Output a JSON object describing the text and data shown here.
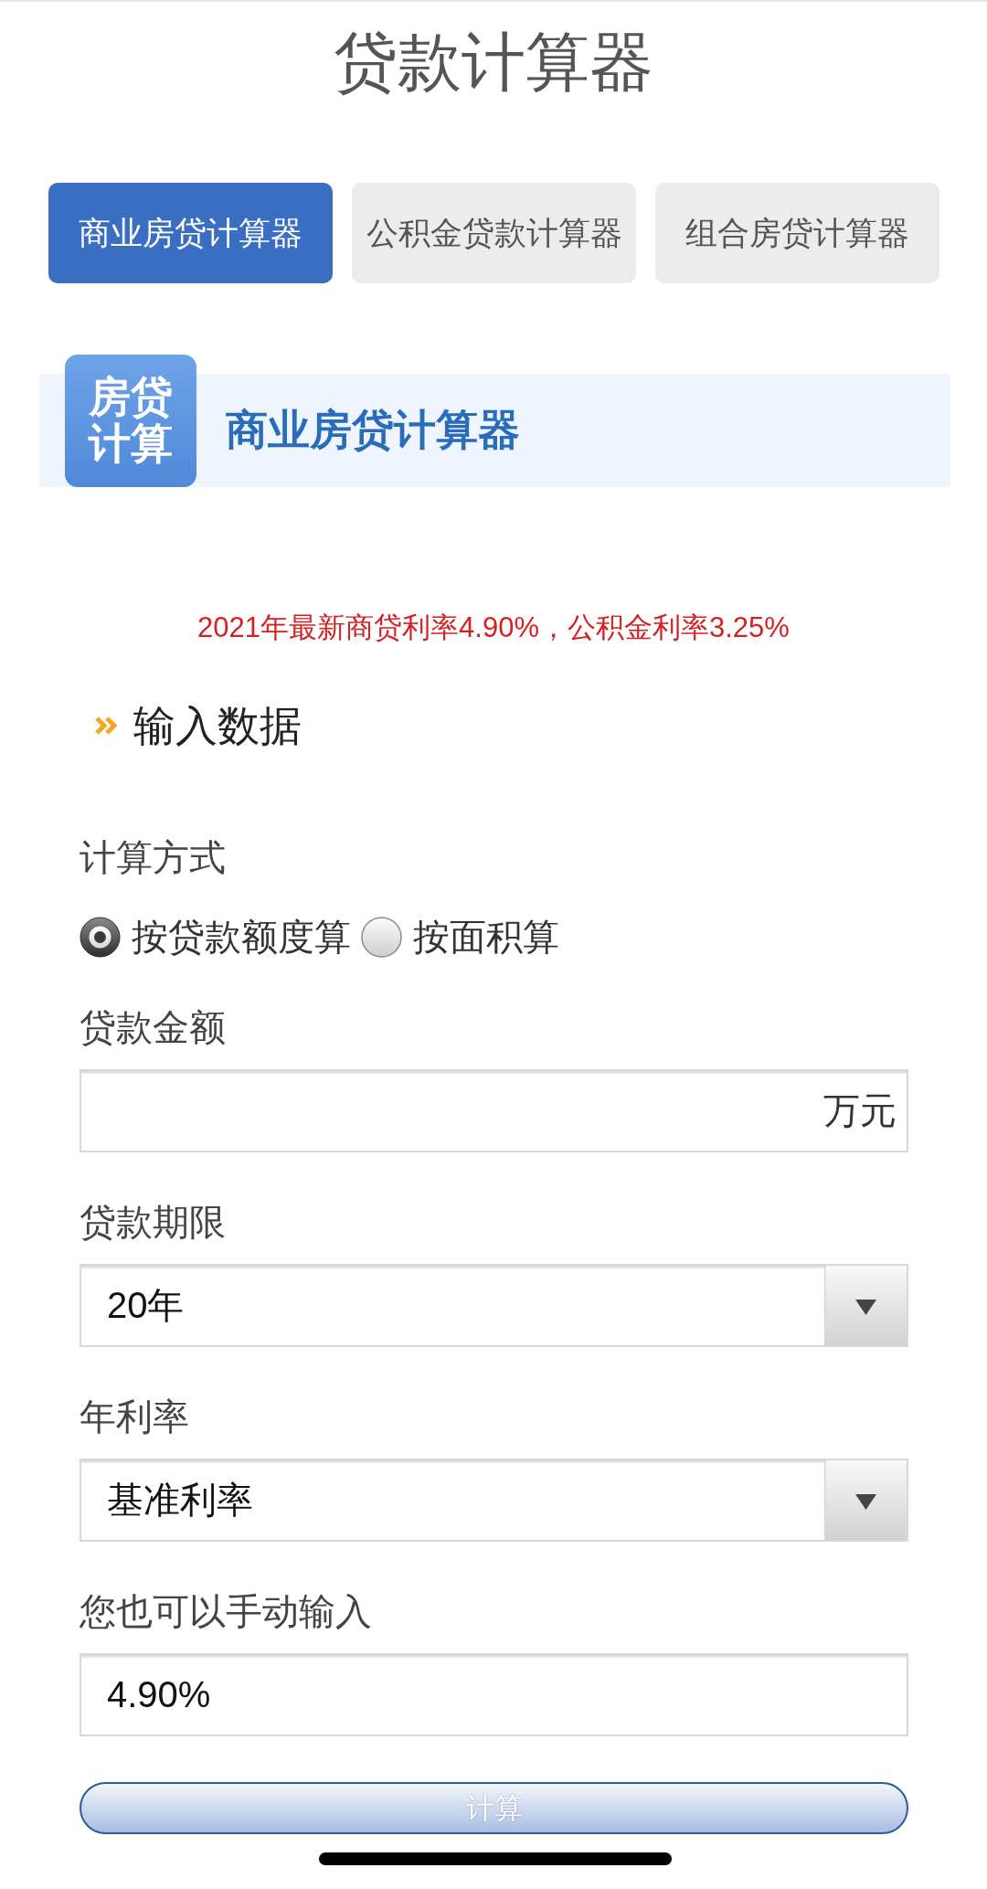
{
  "page": {
    "title": "贷款计算器"
  },
  "tabs": [
    {
      "label": "商业房贷计算器",
      "selected": true
    },
    {
      "label": "公积金贷款计算器",
      "selected": false
    },
    {
      "label": "组合房贷计算器",
      "selected": false
    }
  ],
  "section_header": {
    "badge": "房贷计算",
    "title": "商业房贷计算器"
  },
  "notice": "2021年最新商贷利率4.90%，公积金利率3.25%",
  "input_section": {
    "heading": "输入数据",
    "fields": [
      {
        "kind": "radio",
        "label": "计算方式",
        "options": [
          {
            "label": "按贷款额度算",
            "selected": true
          },
          {
            "label": "按面积算",
            "selected": false
          }
        ]
      },
      {
        "kind": "text",
        "label": "贷款金额",
        "unit": "万元"
      },
      {
        "kind": "select",
        "label": "贷款期限",
        "value": "20年"
      },
      {
        "kind": "select",
        "label": "年利率",
        "value": "基准利率"
      },
      {
        "kind": "text",
        "label": "您也可以手动输入",
        "value": "4.90%"
      }
    ]
  },
  "submit_button": {
    "label": "计算"
  }
}
